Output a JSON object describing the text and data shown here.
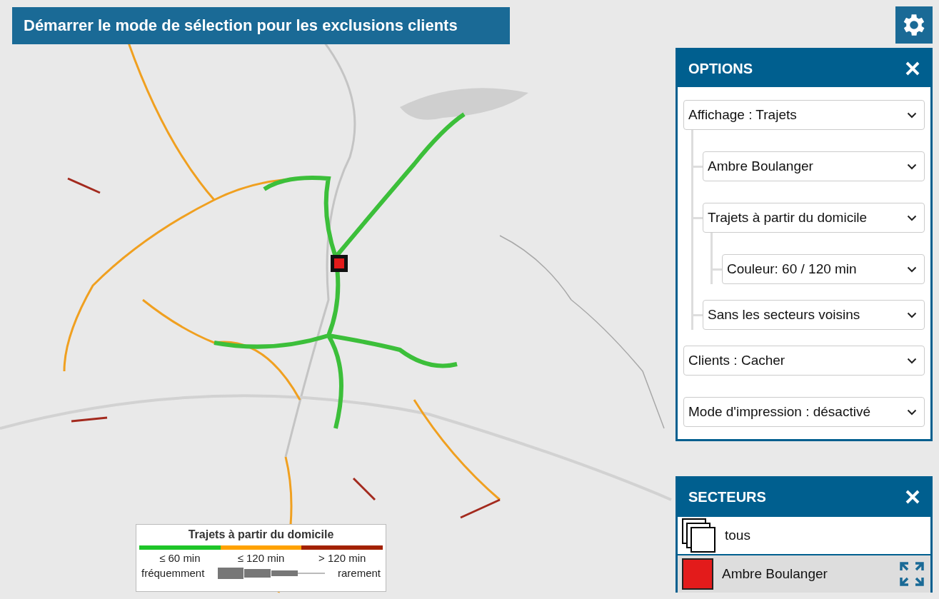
{
  "selection_button": {
    "label": "Démarrer le mode de sélection pour les exclusions clients"
  },
  "options": {
    "title": "OPTIONS",
    "selects": [
      {
        "value": "Affichage : Trajets",
        "children": [
          {
            "value": "Ambre Boulanger"
          },
          {
            "value": "Trajets à partir du domicile",
            "children": [
              {
                "value": "Couleur: 60 / 120 min"
              }
            ]
          },
          {
            "value": "Sans les secteurs voisins"
          }
        ]
      },
      {
        "value": "Clients : Cacher"
      },
      {
        "value": "Mode d'impression : désactivé"
      }
    ]
  },
  "sectors": {
    "title": "SECTEURS",
    "items": [
      {
        "label": "tous",
        "kind": "all",
        "selected": false
      },
      {
        "label": "Ambre Boulanger",
        "kind": "sector",
        "color": "#e31b1b",
        "selected": true
      }
    ]
  },
  "legend": {
    "title": "Trajets à partir du domicile",
    "bands": [
      {
        "label": "≤ 60 min",
        "color": "#1ec528"
      },
      {
        "label": "≤ 120 min",
        "color": "#ffa200"
      },
      {
        "label": "> 120 min",
        "color": "#a32100"
      }
    ],
    "frequent": "fréquemment",
    "rare": "rarement"
  }
}
